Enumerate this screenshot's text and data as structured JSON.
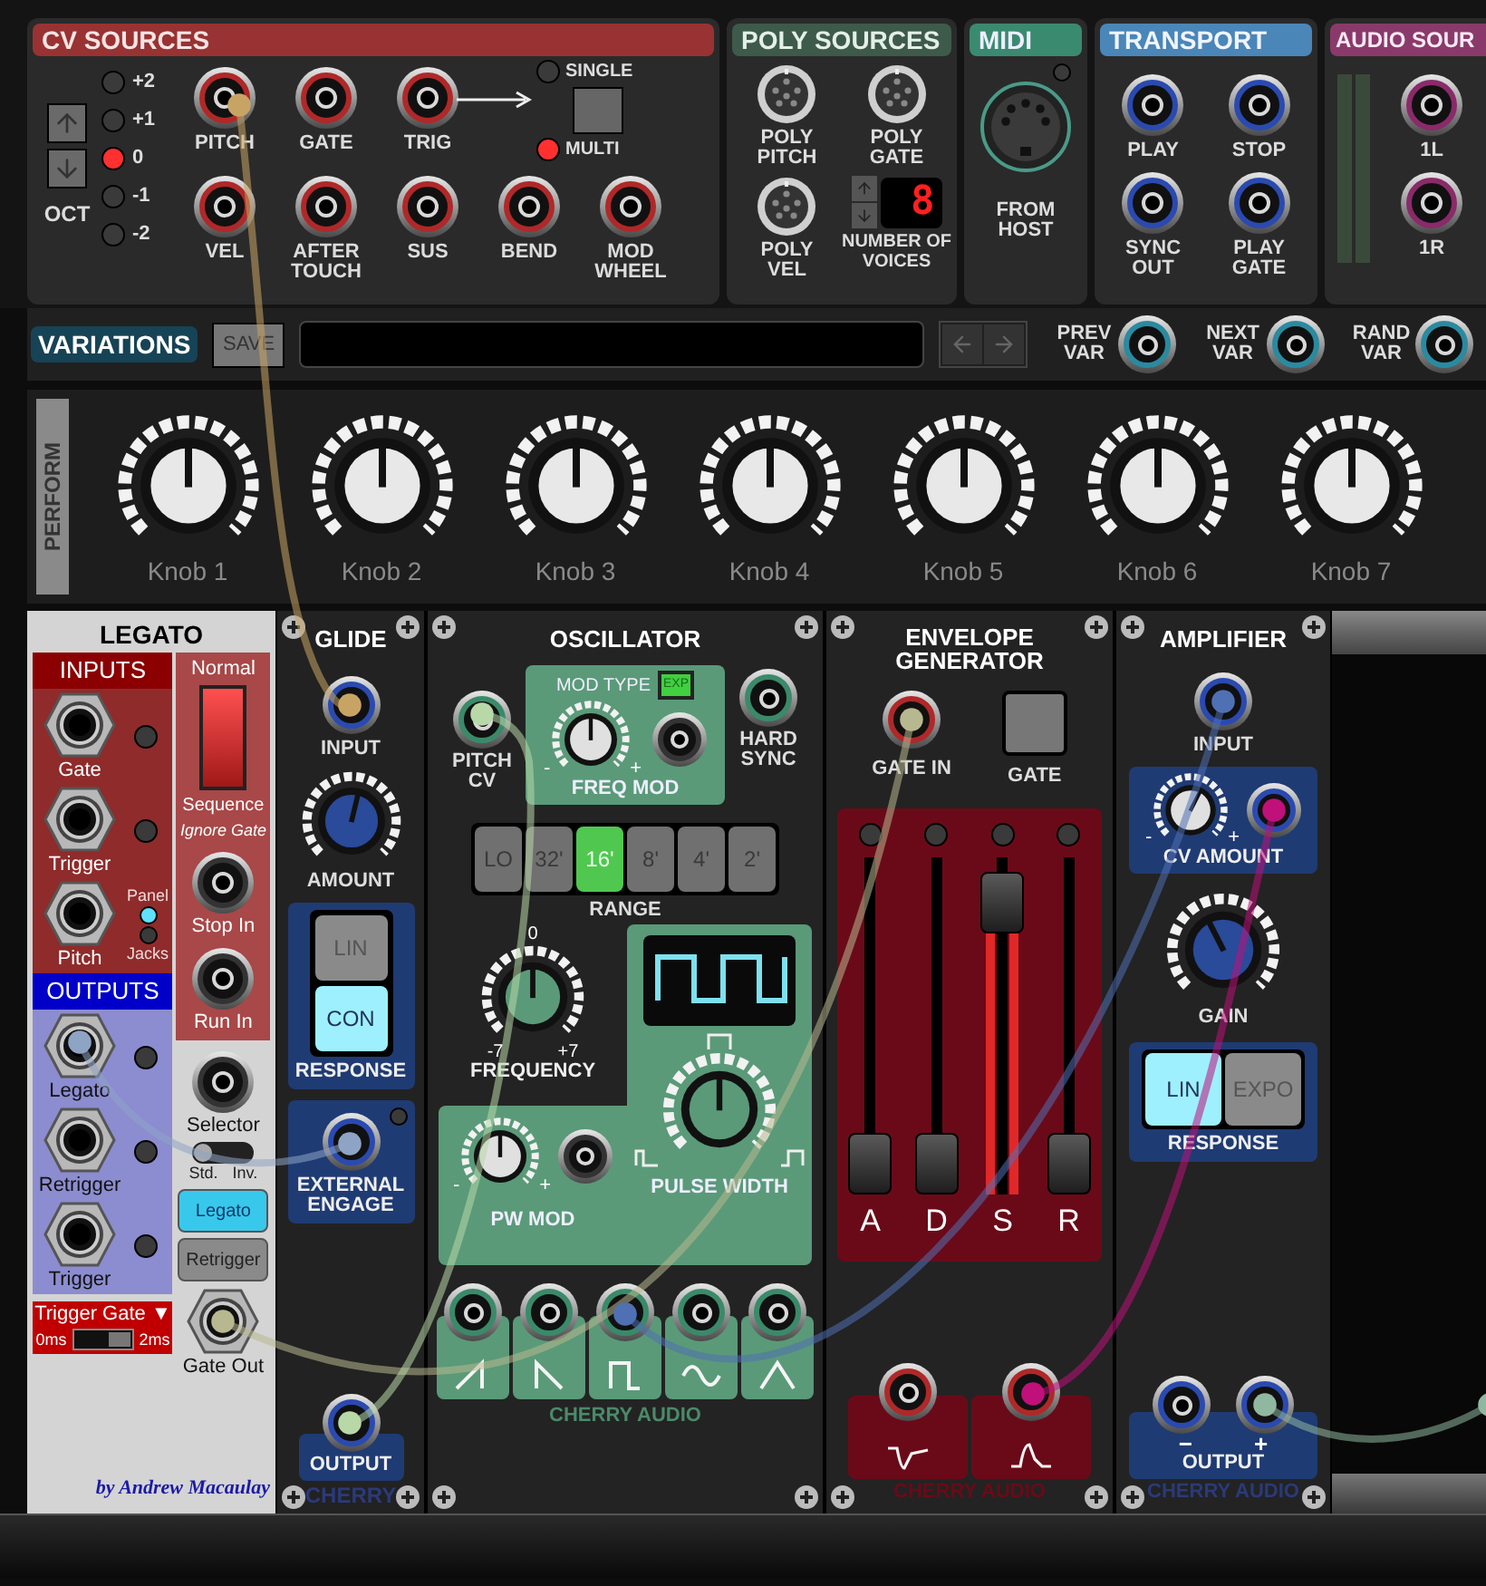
{
  "cv_sources": {
    "title": "CV SOURCES",
    "octave": {
      "label": "OCT",
      "leds": [
        {
          "label": "+2",
          "on": false
        },
        {
          "label": "+1",
          "on": false
        },
        {
          "label": "0",
          "on": true
        },
        {
          "label": "-1",
          "on": false
        },
        {
          "label": "-2",
          "on": false
        }
      ]
    },
    "jacks_top": [
      "PITCH",
      "GATE",
      "TRIG"
    ],
    "trig_modes": [
      {
        "label": "SINGLE",
        "on": false
      },
      {
        "label": "MULTI",
        "on": true
      }
    ],
    "jacks_bottom": [
      "VEL",
      "AFTER TOUCH",
      "SUS",
      "BEND",
      "MOD WHEEL"
    ]
  },
  "poly_sources": {
    "title": "POLY SOURCES",
    "jacks": [
      "POLY PITCH",
      "POLY GATE",
      "POLY VEL"
    ],
    "voices": {
      "label": "NUMBER OF VOICES",
      "display": "8"
    }
  },
  "midi": {
    "title": "MIDI",
    "port": "FROM HOST"
  },
  "transport": {
    "title": "TRANSPORT",
    "jacks": [
      "PLAY",
      "STOP",
      "SYNC OUT",
      "PLAY GATE"
    ]
  },
  "audio_sources": {
    "title": "AUDIO SOUR",
    "jacks": [
      "1L",
      "1R"
    ]
  },
  "variations": {
    "title": "VARIATIONS",
    "save": "SAVE",
    "jacks": [
      "PREV VAR",
      "NEXT VAR",
      "RAND VAR"
    ]
  },
  "perform": {
    "title": "PERFORM",
    "knobs": [
      {
        "label": "Knob 1",
        "level": 0.5
      },
      {
        "label": "Knob 2",
        "level": 0.5
      },
      {
        "label": "Knob 3",
        "level": 0.5
      },
      {
        "label": "Knob 4",
        "level": 0.5
      },
      {
        "label": "Knob 5",
        "level": 0.5
      },
      {
        "label": "Knob 6",
        "level": 0.5
      },
      {
        "label": "Knob 7",
        "level": 0.5
      }
    ]
  },
  "legato": {
    "title": "LEGATO",
    "inputs_title": "INPUTS",
    "inputs": [
      "Gate",
      "Trigger",
      "Pitch"
    ],
    "source": [
      {
        "label": "Panel",
        "on": true
      },
      {
        "label": "Jacks",
        "on": false
      }
    ],
    "mode": {
      "top": "Normal",
      "bottom": "Sequence",
      "note": "Ignore Gate",
      "sequence": false
    },
    "control_jacks": [
      "Stop In",
      "Run In"
    ],
    "outputs_title": "OUTPUTS",
    "outputs": [
      "Legato",
      "Retrigger",
      "Trigger"
    ],
    "selector": {
      "label": "Selector",
      "left": "Std.",
      "right": "Inv.",
      "inverted": false
    },
    "out_modes": [
      {
        "label": "Legato",
        "selected": true
      },
      {
        "label": "Retrigger",
        "selected": false
      }
    ],
    "trigger_gate": {
      "label": "Trigger Gate ▼",
      "min": "0ms",
      "max": "2ms",
      "long": true
    },
    "gate_out": "Gate Out",
    "credit": "by Andrew Macaulay"
  },
  "glide": {
    "title": "GLIDE",
    "input": "INPUT",
    "amount": {
      "label": "AMOUNT",
      "level": 0.55
    },
    "response": {
      "label": "RESPONSE",
      "options": [
        {
          "label": "LIN",
          "selected": false
        },
        {
          "label": "CON",
          "selected": true
        }
      ]
    },
    "engage": "EXTERNAL ENGAGE",
    "output": "OUTPUT",
    "brand": "CHERRY"
  },
  "oscillator": {
    "title": "OSCILLATOR",
    "pitch_cv": "PITCH CV",
    "freq_mod": {
      "mod_type": "MOD TYPE",
      "exp_label": "EXP",
      "exp_on": true,
      "label": "FREQ MOD",
      "min": "-",
      "max": "+",
      "level": 0.5
    },
    "hard_sync": "HARD SYNC",
    "range": {
      "label": "RANGE",
      "options": [
        {
          "label": "LO",
          "selected": false
        },
        {
          "label": "32'",
          "selected": false
        },
        {
          "label": "16'",
          "selected": true
        },
        {
          "label": "8'",
          "selected": false
        },
        {
          "label": "4'",
          "selected": false
        },
        {
          "label": "2'",
          "selected": false
        }
      ]
    },
    "frequency": {
      "label": "FREQUENCY",
      "center": "0",
      "min": "-7",
      "max": "+7",
      "level": 0.5
    },
    "pw_mod": {
      "label": "PW MOD",
      "min": "-",
      "max": "+",
      "level": 0.5
    },
    "pulse_width": {
      "label": "PULSE WIDTH",
      "level": 0.5
    },
    "outputs": [
      {
        "kind": "saw_up"
      },
      {
        "kind": "saw_down"
      },
      {
        "kind": "square"
      },
      {
        "kind": "sine"
      },
      {
        "kind": "triangle"
      }
    ],
    "brand": "CHERRY AUDIO"
  },
  "envelope": {
    "title": "ENVELOPE GENERATOR",
    "gate_in": "GATE IN",
    "gate": "GATE",
    "sliders": [
      {
        "label": "A",
        "level": 0
      },
      {
        "label": "D",
        "level": 0
      },
      {
        "label": "S",
        "level": 0.95
      },
      {
        "label": "R",
        "level": 0
      }
    ],
    "outputs": [
      {
        "kind": "inverted"
      },
      {
        "kind": "normal"
      }
    ],
    "brand": "CHERRY AUDIO"
  },
  "amplifier": {
    "title": "AMPLIFIER",
    "input": "INPUT",
    "cv_amount": {
      "label": "CV AMOUNT",
      "min": "-",
      "max": "+",
      "level": 0.6
    },
    "gain": {
      "label": "GAIN",
      "level": 0.4
    },
    "response": {
      "label": "RESPONSE",
      "options": [
        {
          "label": "LIN",
          "selected": true
        },
        {
          "label": "EXPO",
          "selected": false
        }
      ]
    },
    "output": {
      "label": "OUTPUT",
      "minus": "−",
      "plus": "+"
    },
    "brand": "CHERRY AUDIO"
  },
  "cables": [
    {
      "color": "#c8a464"
    },
    {
      "color": "#b8b890"
    },
    {
      "color": "#8ea4c4"
    },
    {
      "color": "#b8d8a8"
    },
    {
      "color": "#5070b4"
    },
    {
      "color": "#c0107a"
    },
    {
      "color": "#90b8a0"
    }
  ]
}
